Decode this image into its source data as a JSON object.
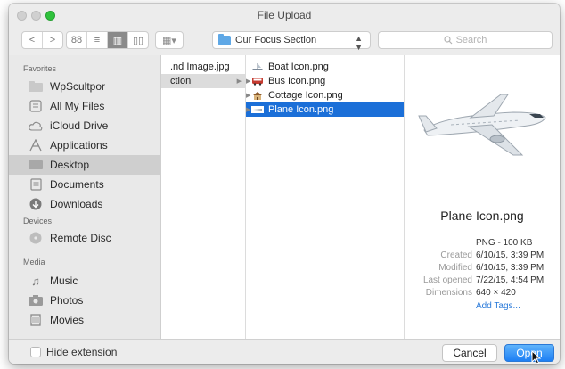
{
  "window": {
    "title": "File Upload"
  },
  "toolbar": {
    "back": "<",
    "forward": ">",
    "view_icons": "88",
    "view_list": "≡",
    "view_columns": "▥",
    "view_coverflow": "▯▯",
    "arrange": "▦▾",
    "location": "Our Focus Section",
    "search_placeholder": "Search"
  },
  "sidebar": {
    "favorites_header": "Favorites",
    "devices_header": "Devices",
    "media_header": "Media",
    "favorites": [
      {
        "label": "WpScultpor",
        "icon": "folder-icon"
      },
      {
        "label": "All My Files",
        "icon": "all-files-icon"
      },
      {
        "label": "iCloud Drive",
        "icon": "cloud-icon"
      },
      {
        "label": "Applications",
        "icon": "applications-icon"
      },
      {
        "label": "Desktop",
        "icon": "desktop-icon",
        "selected": true
      },
      {
        "label": "Documents",
        "icon": "documents-icon"
      },
      {
        "label": "Downloads",
        "icon": "downloads-icon"
      }
    ],
    "devices": [
      {
        "label": "Remote Disc",
        "icon": "disc-icon"
      }
    ],
    "media": [
      {
        "label": "Music",
        "icon": "music-icon"
      },
      {
        "label": "Photos",
        "icon": "camera-icon"
      },
      {
        "label": "Movies",
        "icon": "film-icon"
      }
    ]
  },
  "columns": {
    "col1": [
      {
        "label": ".nd Image.jpg"
      },
      {
        "label": "ction",
        "selected": true
      }
    ],
    "col2": [
      {
        "label": "Boat Icon.png",
        "icon": "boat-icon"
      },
      {
        "label": "Bus Icon.png",
        "icon": "bus-icon"
      },
      {
        "label": "Cottage Icon.png",
        "icon": "cottage-icon"
      },
      {
        "label": "Plane Icon.png",
        "icon": "plane-icon",
        "selected": true
      }
    ]
  },
  "preview": {
    "filename": "Plane Icon.png",
    "kind_size": "PNG - 100 KB",
    "created_label": "Created",
    "created_value": "6/10/15, 3:39 PM",
    "modified_label": "Modified",
    "modified_value": "6/10/15, 3:39 PM",
    "last_opened_label": "Last opened",
    "last_opened_value": "7/22/15, 4:54 PM",
    "dimensions_label": "Dimensions",
    "dimensions_value": "640 × 420",
    "add_tags": "Add Tags..."
  },
  "bottom": {
    "hide_extension": "Hide extension",
    "cancel": "Cancel",
    "open": "Open"
  },
  "colors": {
    "selection_blue": "#1b6fd8",
    "link_blue": "#2a7ad9",
    "open_button": "#1d7ff4",
    "traffic_green": "#2fc23c"
  }
}
